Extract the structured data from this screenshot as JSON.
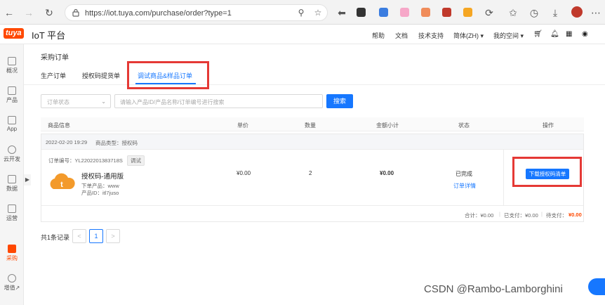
{
  "browser": {
    "url": "https://iot.tuya.com/purchase/order?type=1"
  },
  "app": {
    "logo_badge": "tuya",
    "logo_text": "IoT 平台",
    "nav": [
      "帮助",
      "文档",
      "技术支持",
      "简体(ZH) ▾",
      "我的空间 ▾"
    ]
  },
  "sidebar": {
    "items": [
      {
        "label": "概况"
      },
      {
        "label": "产品"
      },
      {
        "label": "App"
      },
      {
        "label": "云开发"
      },
      {
        "label": "数据"
      },
      {
        "label": "运营"
      },
      {
        "label": "采购"
      },
      {
        "label": "增值↗"
      }
    ],
    "active_index": 6
  },
  "page": {
    "title": "采购订单",
    "tabs": [
      "生产订单",
      "授权码提货单",
      "调试商品&样品订单"
    ],
    "active_tab": 2
  },
  "filter": {
    "status_placeholder": "订单状态",
    "search_placeholder": "请输入产品ID/产品名称/订单编号进行搜索",
    "search_button": "搜索"
  },
  "table": {
    "headers": [
      "商品信息",
      "单价",
      "数量",
      "金额小计",
      "状态",
      "操作"
    ]
  },
  "order": {
    "date": "2022-02-20 19:29",
    "product_type": "商品类型：授权码",
    "order_no": "订单编号：YL2202201383718S",
    "tag": "调试",
    "product_name": "授权码-通用版",
    "ordered_product": "下单产品：www",
    "product_id": "产品ID：itl7juso",
    "unit_price": "¥0.00",
    "quantity": "2",
    "subtotal": "¥0.00",
    "status": "已完成",
    "detail_link": "订单详情",
    "action_button": "下载授权码清单",
    "footer_total": "合计：¥0.00",
    "footer_paid": "已支付：¥0.00",
    "footer_due_label": "待支付：",
    "footer_due_value": "¥0.00"
  },
  "pagination": {
    "total": "共1条记录",
    "prev": "<",
    "current": "1",
    "next": ">"
  },
  "watermark": "CSDN @Rambo-Lamborghini",
  "colors": {
    "brand": "#ff4800",
    "primary": "#1677ff",
    "highlight_box": "#e53935"
  }
}
